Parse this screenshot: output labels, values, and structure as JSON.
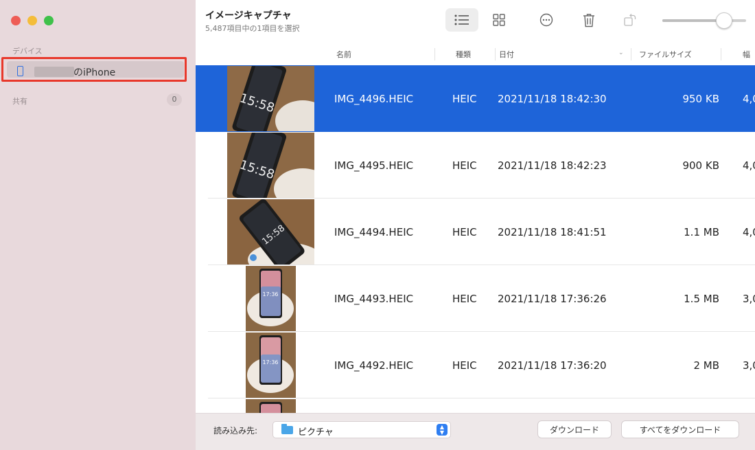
{
  "sidebar": {
    "devices_label": "デバイス",
    "device_name": "のiPhone",
    "shared_label": "共有",
    "shared_count": "0"
  },
  "toolbar": {
    "title": "イメージキャプチャ",
    "subtitle": "5,487項目中の1項目を選択",
    "icons": [
      "list-view-icon",
      "grid-view-icon",
      "more-icon",
      "trash-icon",
      "rotate-icon"
    ],
    "thumbnail_size_fraction": 0.74
  },
  "table": {
    "headers": {
      "name": "名前",
      "kind": "種類",
      "date": "日付",
      "size": "ファイルサイズ",
      "width": "幅"
    },
    "rows": [
      {
        "name": "IMG_4496.HEIC",
        "kind": "HEIC",
        "date": "2021/11/18 18:42:30",
        "size": "950 KB",
        "width": "4,0",
        "selected": true
      },
      {
        "name": "IMG_4495.HEIC",
        "kind": "HEIC",
        "date": "2021/11/18 18:42:23",
        "size": "900 KB",
        "width": "4,0",
        "selected": false
      },
      {
        "name": "IMG_4494.HEIC",
        "kind": "HEIC",
        "date": "2021/11/18 18:41:51",
        "size": "1.1 MB",
        "width": "4,0",
        "selected": false
      },
      {
        "name": "IMG_4493.HEIC",
        "kind": "HEIC",
        "date": "2021/11/18 17:36:26",
        "size": "1.5 MB",
        "width": "3,0",
        "selected": false
      },
      {
        "name": "IMG_4492.HEIC",
        "kind": "HEIC",
        "date": "2021/11/18 17:36:20",
        "size": "2 MB",
        "width": "3,0",
        "selected": false
      }
    ]
  },
  "footer": {
    "import_label": "読み込み先:",
    "import_value": "ピクチャ",
    "download_label": "ダウンロード",
    "download_all_label": "すべてをダウンロード"
  },
  "thumb_text": {
    "a": "15:58",
    "b": "17:36"
  },
  "colors": {
    "accent": "#1e64d9",
    "highlight_border": "#e8382b",
    "sidebar_bg": "#e8d9dc"
  }
}
